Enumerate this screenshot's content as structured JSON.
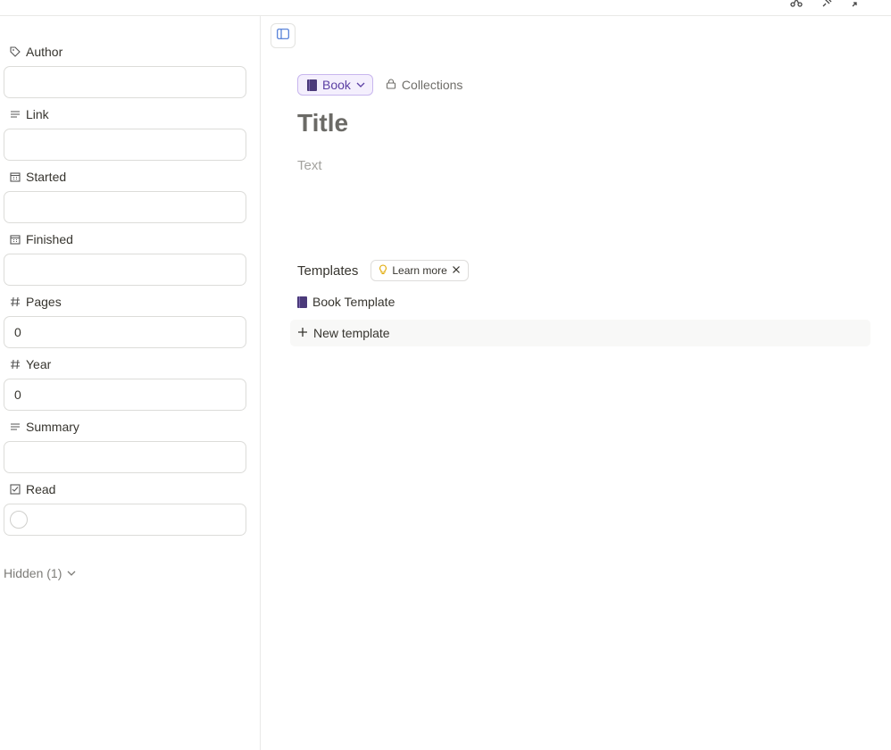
{
  "sidebar": {
    "properties": [
      {
        "label": "Author",
        "icon": "tag-icon",
        "value": ""
      },
      {
        "label": "Link",
        "icon": "text-lines-icon",
        "value": ""
      },
      {
        "label": "Started",
        "icon": "calendar-icon",
        "value": ""
      },
      {
        "label": "Finished",
        "icon": "calendar-icon",
        "value": ""
      },
      {
        "label": "Pages",
        "icon": "hash-icon",
        "value": "0"
      },
      {
        "label": "Year",
        "icon": "hash-icon",
        "value": "0"
      },
      {
        "label": "Summary",
        "icon": "text-lines-icon",
        "value": ""
      },
      {
        "label": "Read",
        "icon": "checkbox-icon",
        "value": ""
      }
    ],
    "hidden_label": "Hidden (1)"
  },
  "main": {
    "type_label": "Book",
    "collections_label": "Collections",
    "title_placeholder": "Title",
    "text_placeholder": "Text",
    "templates_title": "Templates",
    "learn_more_label": "Learn more",
    "template_item": "Book Template",
    "new_template_label": "New template"
  },
  "colors": {
    "accent_purple": "#5b3fa3",
    "pill_bg": "#f4effd",
    "border": "#dcdcd9",
    "lightbulb": "#e0a800"
  }
}
